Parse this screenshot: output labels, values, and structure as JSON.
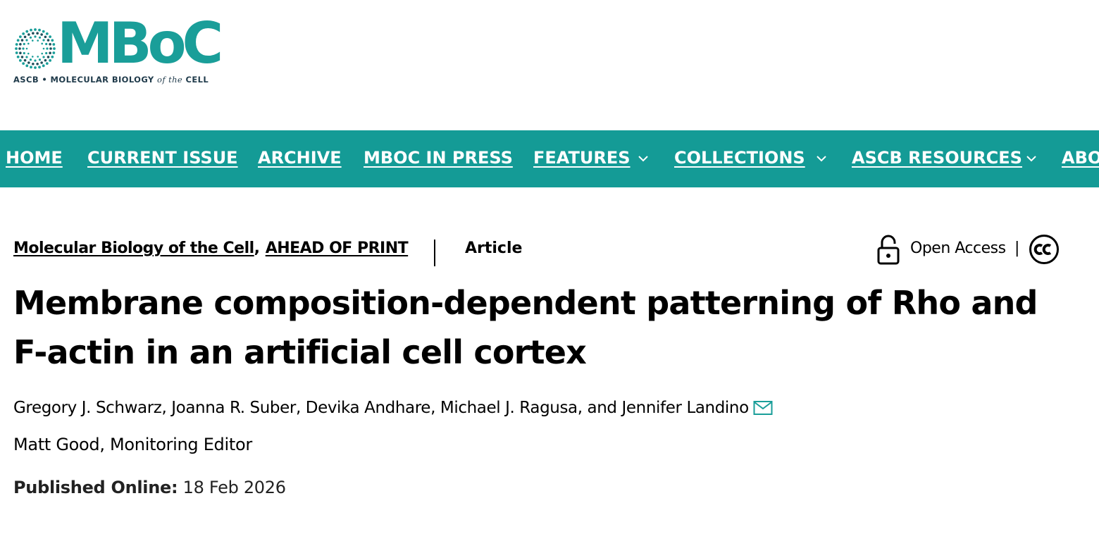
{
  "logo": {
    "wordmark": "MBoC",
    "tagline_part1": "ASCB • MOLECULAR BIOLOGY ",
    "tagline_italic": "of the",
    "tagline_part2": " CELL",
    "brand_color": "#1a9e99",
    "tagline_color": "#1f3a4a"
  },
  "nav": {
    "background": "#149b96",
    "items": [
      {
        "label": "HOME",
        "dropdown": false
      },
      {
        "label": "CURRENT ISSUE",
        "dropdown": false
      },
      {
        "label": "ARCHIVE",
        "dropdown": false
      },
      {
        "label": "MBOC IN PRESS",
        "dropdown": false
      },
      {
        "label": "FEATURES",
        "dropdown": true
      },
      {
        "label": "COLLECTIONS",
        "dropdown": true
      },
      {
        "label": "ASCB RESOURCES",
        "dropdown": true
      },
      {
        "label": "ABO",
        "dropdown": false
      }
    ]
  },
  "meta": {
    "journal": "Molecular Biology of the Cell",
    "comma": ",",
    "issue": "AHEAD OF PRINT",
    "type": "Article"
  },
  "access": {
    "label": "Open Access",
    "separator": "|",
    "license_icon": "cc-icon",
    "lock_icon": "unlock-icon"
  },
  "article": {
    "title": "Membrane composition-dependent patterning of Rho and F-actin in an artificial cell cortex",
    "authors": [
      {
        "name": "Gregory J. Schwarz",
        "sep": ", "
      },
      {
        "name": "Joanna R. Suber",
        "sep": ", "
      },
      {
        "name": "Devika Andhare",
        "sep": ", "
      },
      {
        "name": "Michael J. Ragusa",
        "sep": ", and "
      },
      {
        "name": "Jennifer Landino",
        "sep": ""
      }
    ],
    "contact_icon": "mail-icon",
    "editor": "Matt Good, Monitoring Editor",
    "published_label": "Published Online:",
    "published_date": "18 Feb 2026"
  }
}
